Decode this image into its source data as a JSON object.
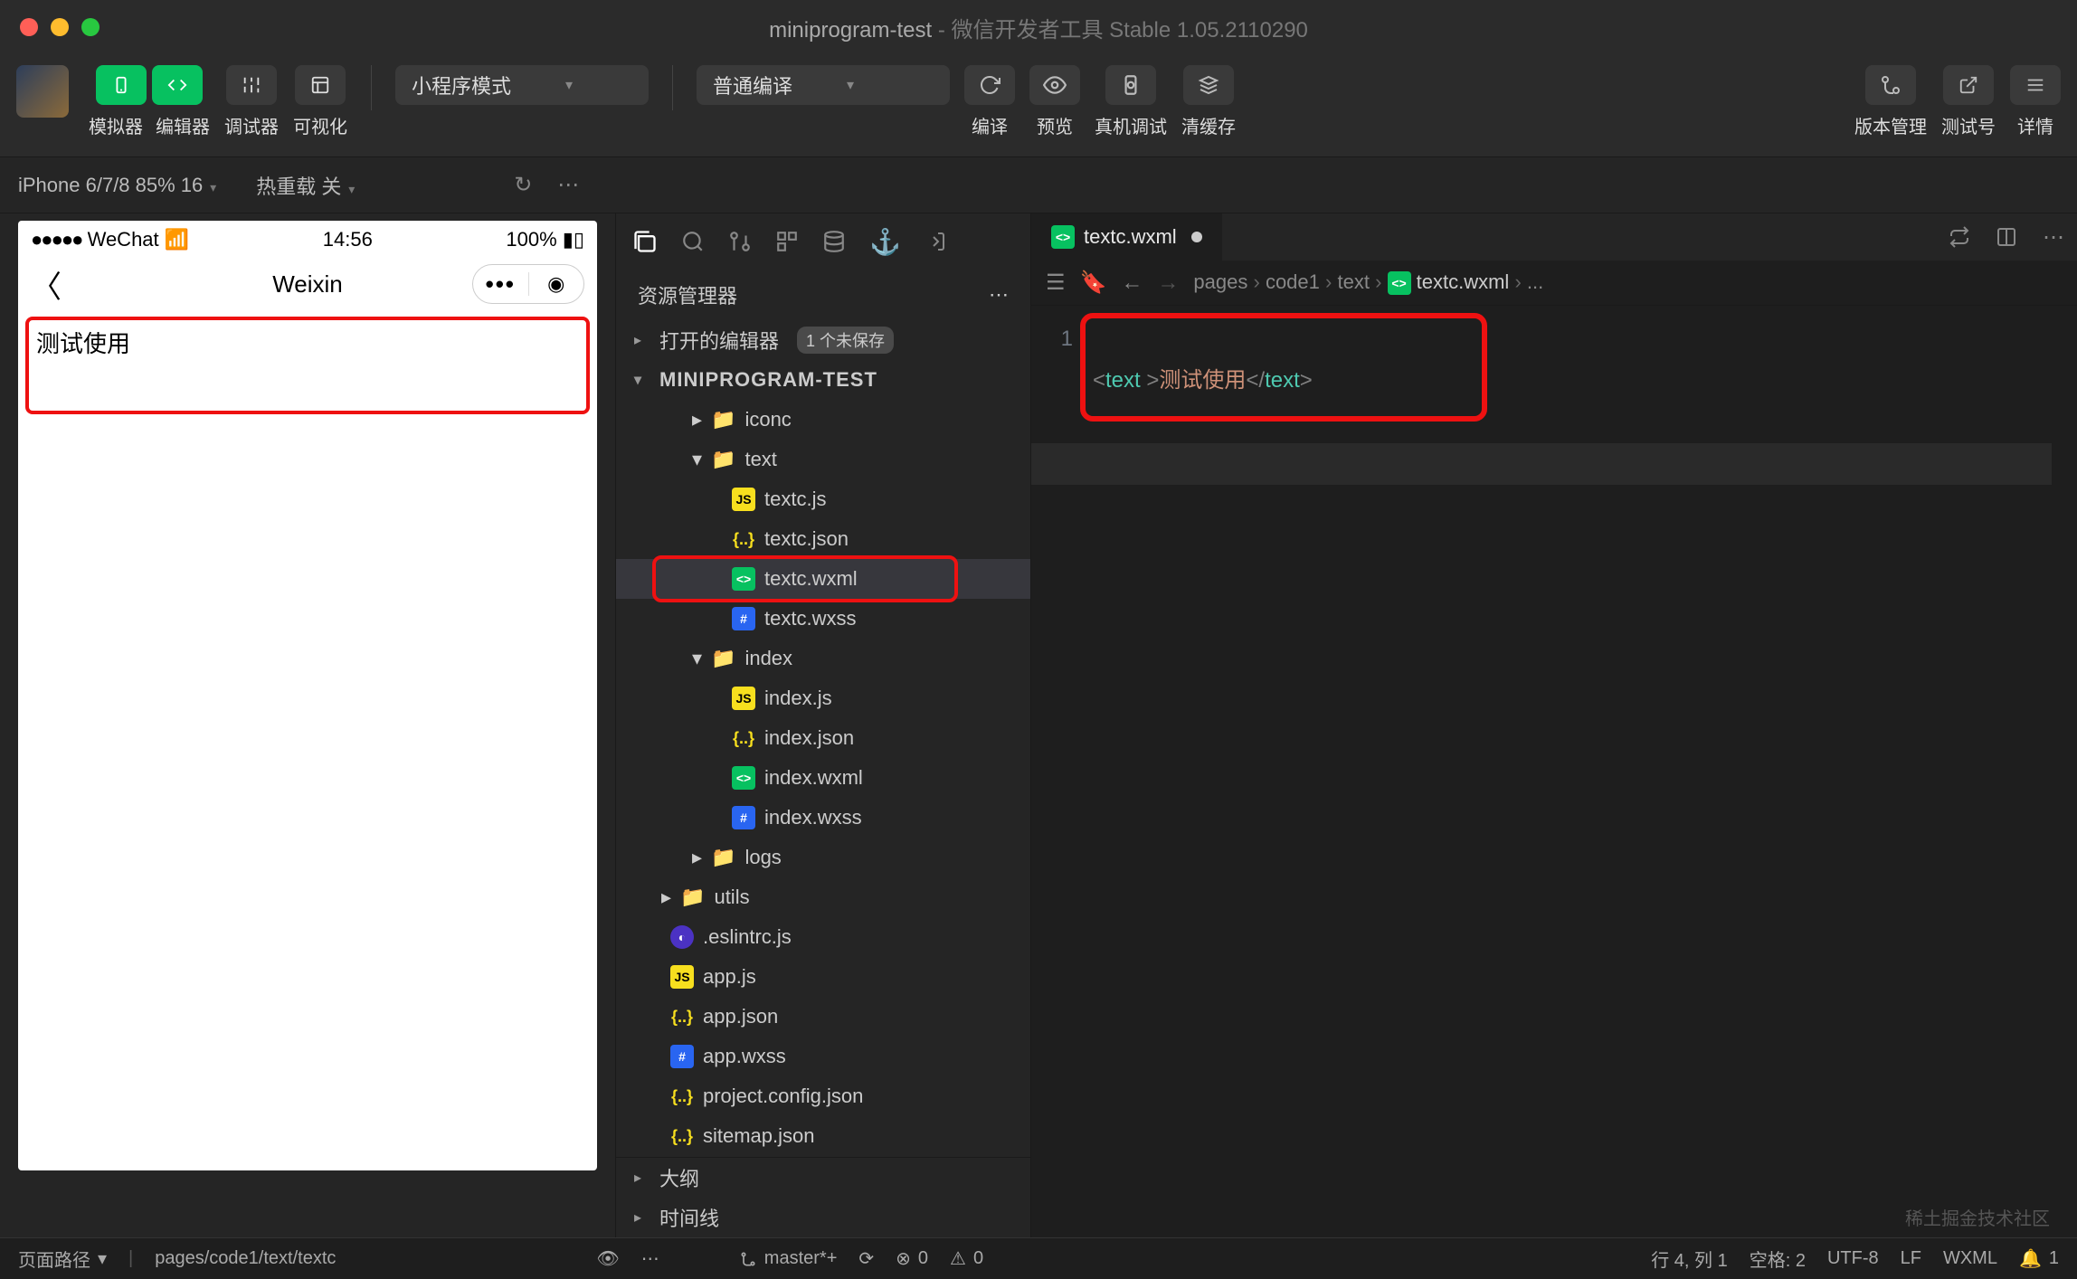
{
  "titlebar": {
    "project": "miniprogram-test",
    "app": "微信开发者工具 Stable 1.05.2110290"
  },
  "toolbar": {
    "simulator": "模拟器",
    "editor": "编辑器",
    "debugger": "调试器",
    "visual": "可视化",
    "mode_dropdown": "小程序模式",
    "compile_dropdown": "普通编译",
    "compile": "编译",
    "preview": "预览",
    "remote_debug": "真机调试",
    "clear_cache": "清缓存",
    "version_mgmt": "版本管理",
    "test_number": "测试号",
    "details": "详情"
  },
  "subbar": {
    "device": "iPhone 6/7/8 85% 16",
    "hot_reload": "热重载 关"
  },
  "simulator": {
    "carrier": "WeChat",
    "time": "14:56",
    "battery": "100%",
    "nav_title": "Weixin",
    "body_text": "测试使用"
  },
  "explorer": {
    "title": "资源管理器",
    "open_editors": "打开的编辑器",
    "unsaved_badge": "1 个未保存",
    "project": "MINIPROGRAM-TEST",
    "outline": "大纲",
    "timeline": "时间线",
    "tree": [
      {
        "depth": 1,
        "type": "folder",
        "open": false,
        "name": "iconc"
      },
      {
        "depth": 1,
        "type": "folder",
        "open": true,
        "name": "text"
      },
      {
        "depth": 2,
        "type": "js",
        "name": "textc.js"
      },
      {
        "depth": 2,
        "type": "json",
        "name": "textc.json"
      },
      {
        "depth": 2,
        "type": "wxml",
        "name": "textc.wxml",
        "selected": true,
        "highlighted": true
      },
      {
        "depth": 2,
        "type": "wxss",
        "name": "textc.wxss"
      },
      {
        "depth": 1,
        "type": "folder",
        "open": true,
        "name": "index"
      },
      {
        "depth": 2,
        "type": "js",
        "name": "index.js"
      },
      {
        "depth": 2,
        "type": "json",
        "name": "index.json"
      },
      {
        "depth": 2,
        "type": "wxml",
        "name": "index.wxml"
      },
      {
        "depth": 2,
        "type": "wxss",
        "name": "index.wxss"
      },
      {
        "depth": 1,
        "type": "folder",
        "open": false,
        "name": "logs"
      },
      {
        "depth": 0,
        "type": "folder",
        "open": false,
        "name": "utils"
      },
      {
        "depth": 0,
        "type": "es",
        "name": ".eslintrc.js"
      },
      {
        "depth": 0,
        "type": "js",
        "name": "app.js"
      },
      {
        "depth": 0,
        "type": "json",
        "name": "app.json"
      },
      {
        "depth": 0,
        "type": "wxss",
        "name": "app.wxss"
      },
      {
        "depth": 0,
        "type": "json",
        "name": "project.config.json"
      },
      {
        "depth": 0,
        "type": "json",
        "name": "sitemap.json"
      }
    ]
  },
  "editor": {
    "tab_name": "textc.wxml",
    "breadcrumb": [
      "pages",
      "code1",
      "text",
      "textc.wxml",
      "..."
    ],
    "line_no": "1",
    "code_tag_open": "<",
    "code_tag": "text",
    "code_space": " ",
    "code_gt": ">",
    "code_text": "测试使用",
    "code_close_open": "</",
    "code_close_gt": ">"
  },
  "statusbar": {
    "page_path_label": "页面路径",
    "page_path": "pages/code1/text/textc",
    "branch": "master*+",
    "errors": "0",
    "warnings": "0",
    "position": "行 4, 列 1",
    "spaces": "空格: 2",
    "encoding": "UTF-8",
    "eol": "LF",
    "lang": "WXML",
    "notif": "1"
  },
  "watermark": "稀土掘金技术社区"
}
